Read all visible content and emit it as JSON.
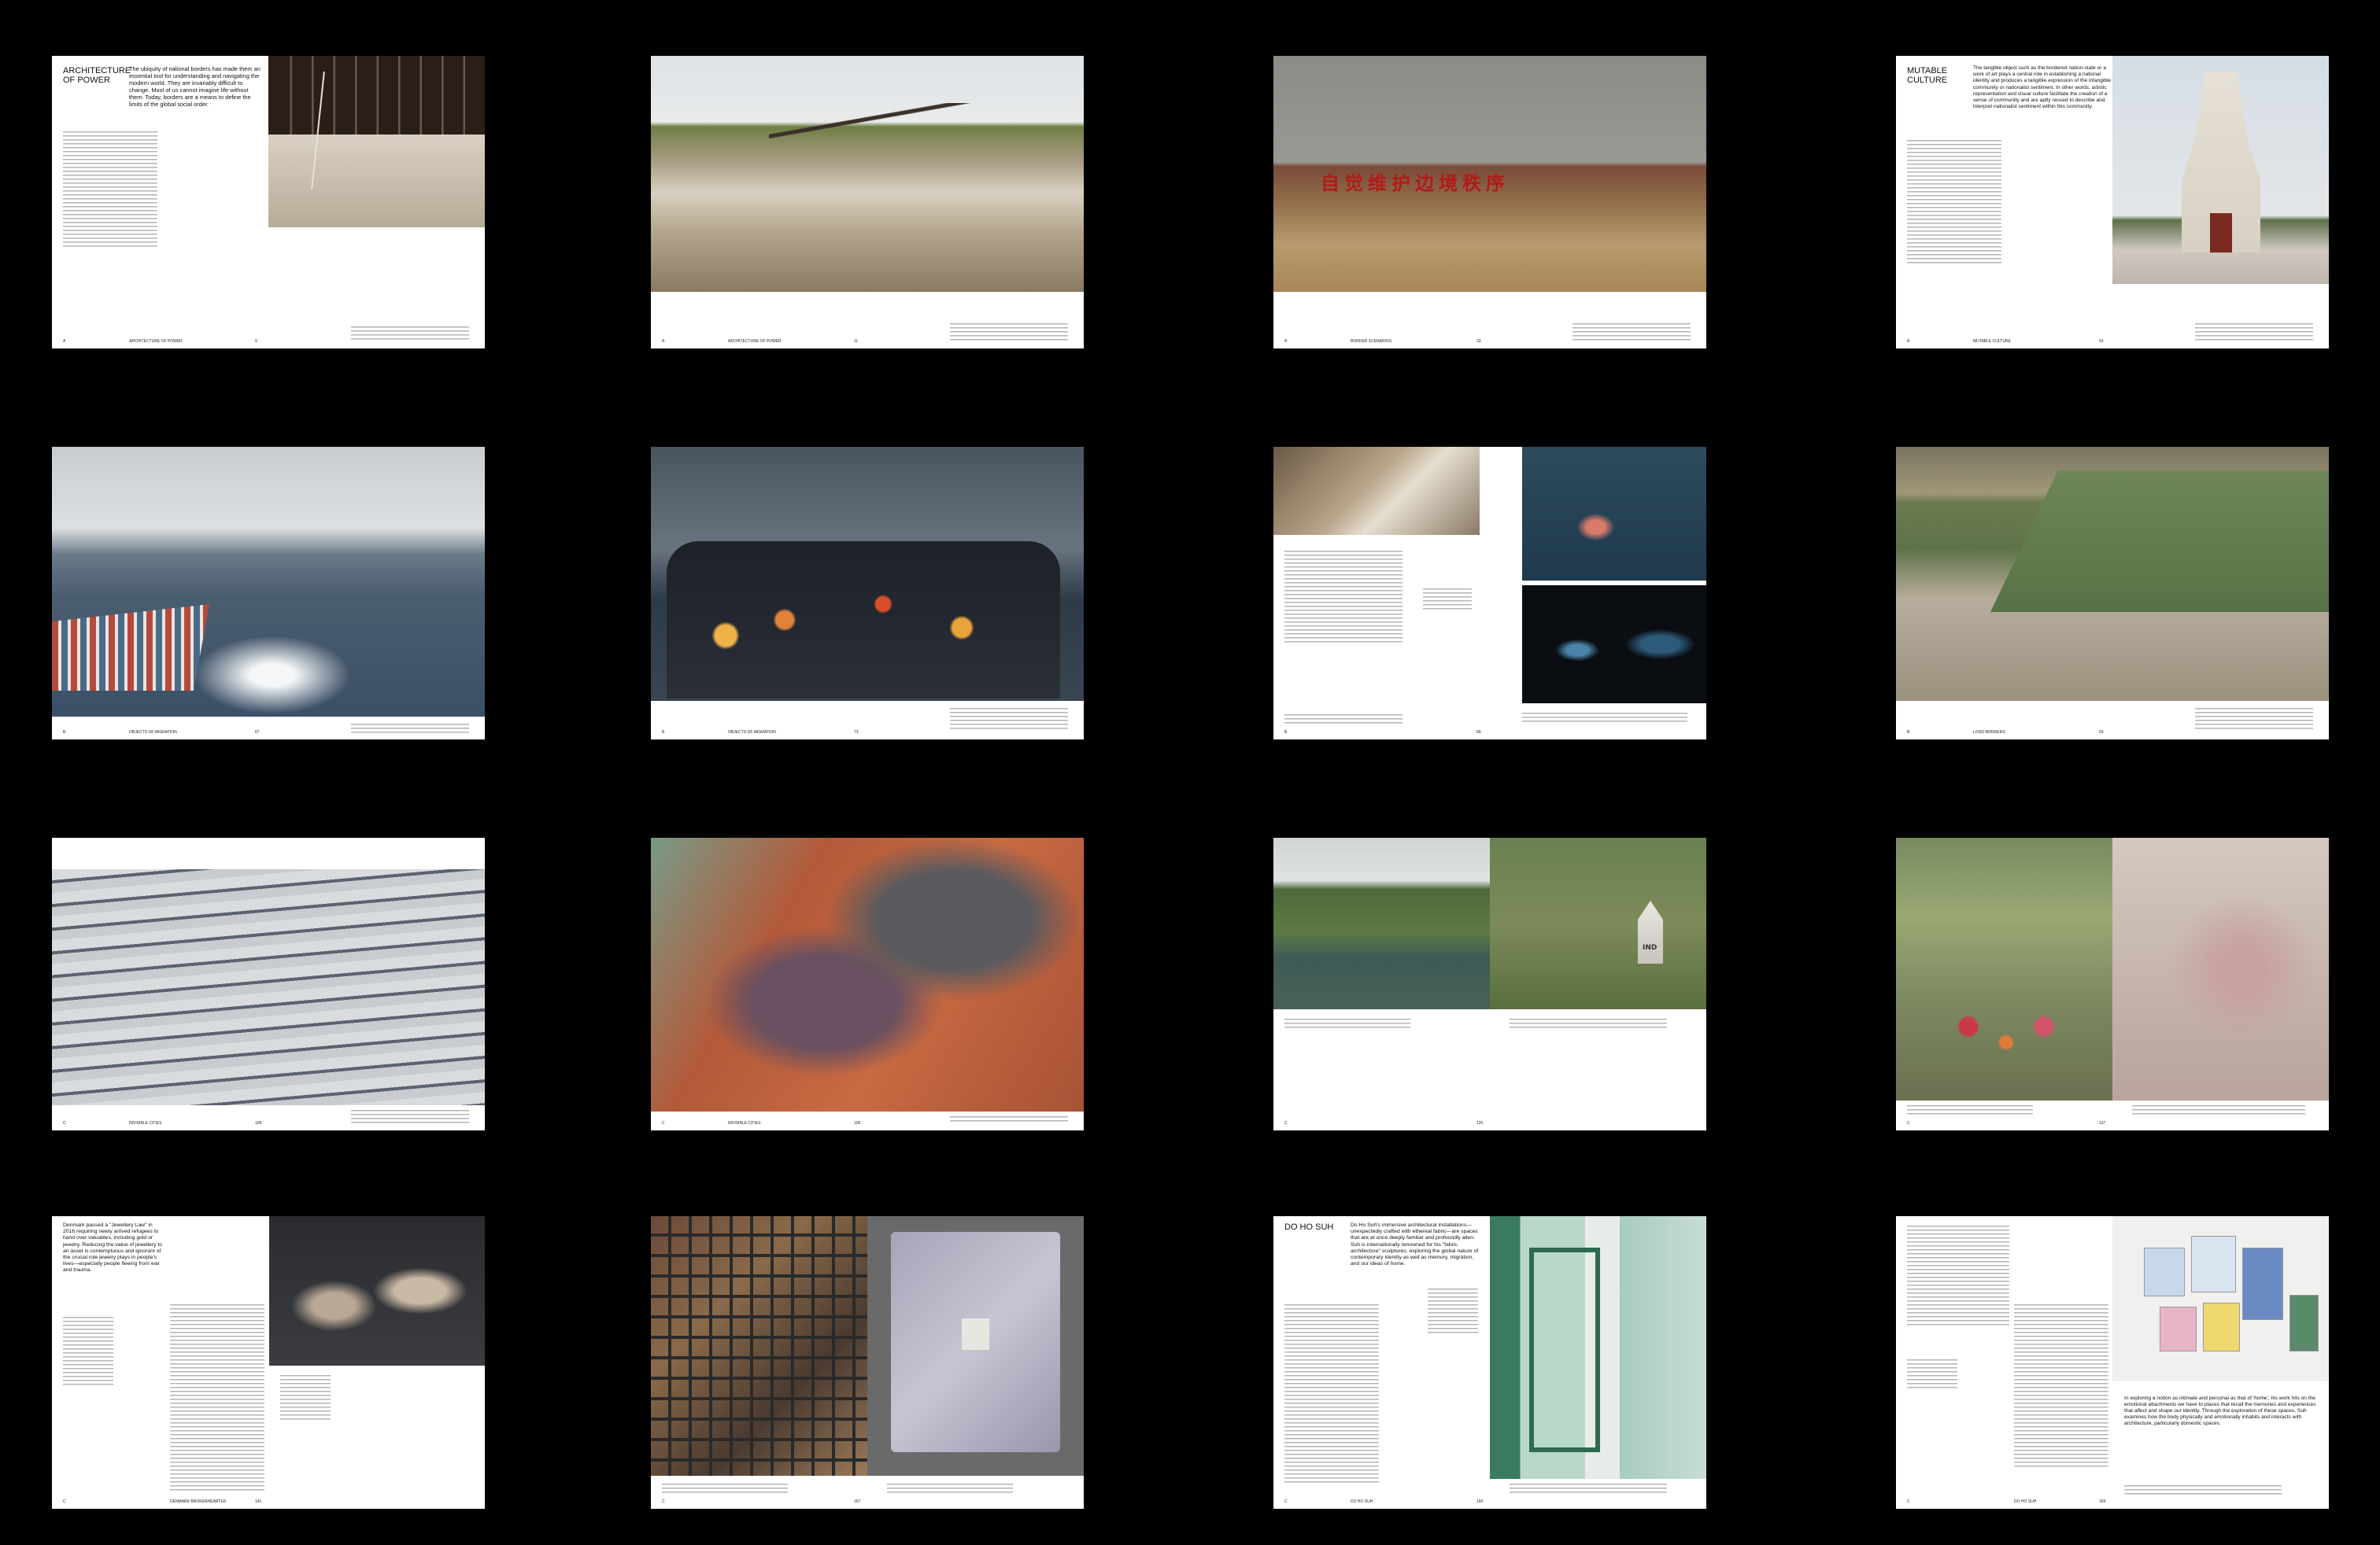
{
  "spreads": [
    {
      "letter": "A",
      "section": "ARCHITECTURE OF POWER",
      "page": "9",
      "title": "ARCHITECTURE OF POWER",
      "lead": "The ubiquity of national borders has made them an essential tool for understanding and navigating the modern world. They are invariably difficult to change. Most of us cannot imagine life without them. Today, borders are a means to define the limits of the global social order."
    },
    {
      "letter": "A",
      "section": "ARCHITECTURE OF POWER",
      "page": "11"
    },
    {
      "letter": "A",
      "section": "BORDER SCENARIOS",
      "page": "33",
      "sign": "自觉维护边境秩序"
    },
    {
      "letter": "A",
      "section": "MUTABLE CULTURE",
      "page": "43",
      "title": "MUTABLE CULTURE",
      "lead": "The tangible object such as the bordered nation-state or a work of art plays a central role in establishing a national identity and produces a tangible expression of the intangible community or nationalist sentiment. In other words, artistic representation and visual culture facilitate the creation of a sense of community and are aptly reused to describe and interpret nationalist sentiment within this community."
    },
    {
      "letter": "B",
      "section": "OBJECTS OF MIGRATION",
      "page": "67"
    },
    {
      "letter": "B",
      "section": "OBJECTS OF MIGRATION",
      "page": "73"
    },
    {
      "letter": "B",
      "section": "",
      "page": "89"
    },
    {
      "letter": "B",
      "section": "LIVED BORDERS",
      "page": "93"
    },
    {
      "letter": "C",
      "section": "INVISIBLE CITIES",
      "page": "109"
    },
    {
      "letter": "C",
      "section": "INVISIBLE CITIES",
      "page": "105"
    },
    {
      "letter": "C",
      "section": "",
      "page": "125",
      "marker": "IND"
    },
    {
      "letter": "C",
      "section": "",
      "page": "137"
    },
    {
      "letter": "C",
      "section": "DENMARK BROKENHEARTED",
      "page": "141",
      "lead": "Denmark passed a \"Jewellery Law\" in 2016 requiring newly arrived refugees to hand over valuables, including gold or jewelry. Reducing the value of jewellery to an asset is contemptuous and ignorant of the crucial role jewelry plays in people's lives—especially people fleeing from war and trauma."
    },
    {
      "letter": "C",
      "section": "",
      "page": "157"
    },
    {
      "letter": "C",
      "section": "DO HO SUH",
      "page": "160",
      "title": "DO HO SUH",
      "lead": "Do Ho Suh's immersive architectural installations—unexpectedly crafted with ethereal fabric—are spaces that are at once deeply familiar and profoundly alien. Suh is internationally renowned for his \"fabric architecture\" sculptures; exploring the global nature of contemporary identity as well as memory, migration, and our ideas of home."
    },
    {
      "letter": "C",
      "section": "DO HO SUH",
      "page": "169",
      "lead": "In exploring a notion as intimate and personal as that of 'home', his work hits on the emotional attachments we have to places that recall the memories and experiences that affect and shape our identity. Through the exploration of these spaces, Suh examines how the body physically and emotionally inhabits and interacts with architecture, particularly domestic spaces."
    }
  ]
}
